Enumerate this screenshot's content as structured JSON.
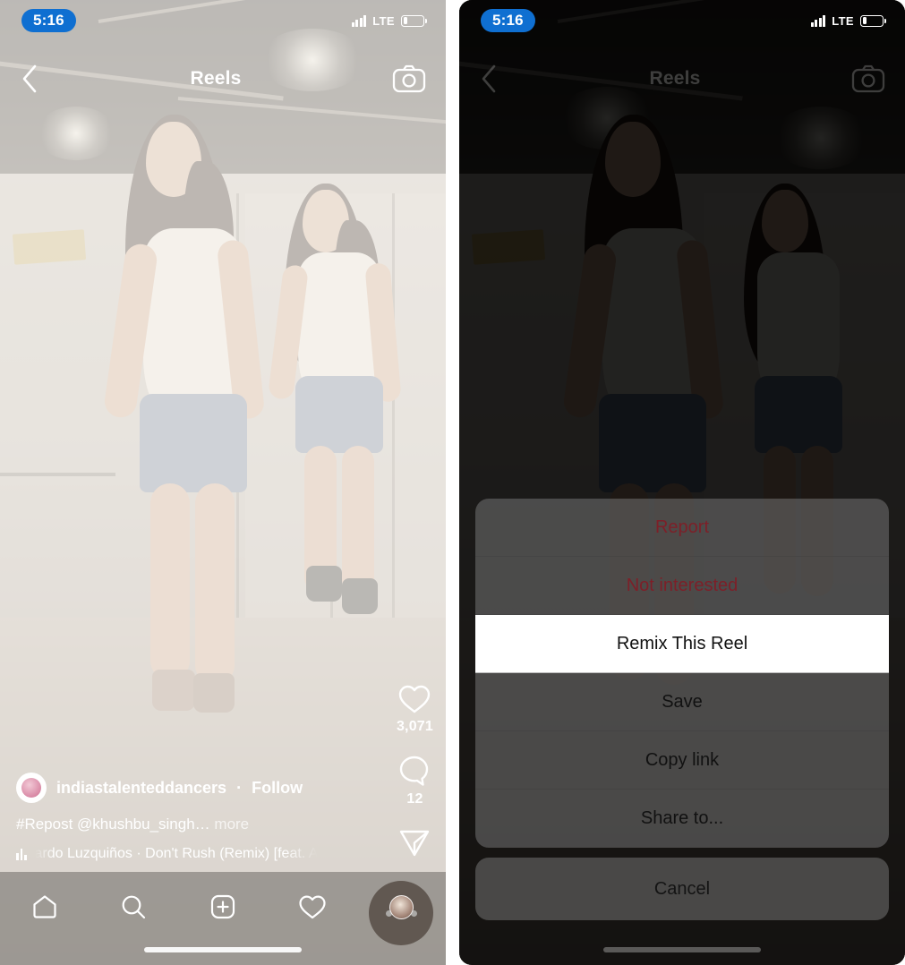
{
  "status_bar": {
    "time": "5:16",
    "carrier_network": "LTE",
    "signal_icon": "signal-bars-icon",
    "battery_icon": "battery-low-icon",
    "time_pill_color": "#0f6fd1"
  },
  "header": {
    "title": "Reels",
    "back_icon": "chevron-left-icon",
    "camera_icon": "camera-icon"
  },
  "reel": {
    "actions": {
      "like_icon": "heart-icon",
      "like_count": "3,071",
      "comment_icon": "comment-bubble-icon",
      "comment_count": "12",
      "share_icon": "paper-plane-icon",
      "more_icon": "ellipsis-icon"
    },
    "author": {
      "avatar_icon": "profile-avatar",
      "username": "indiastalenteddancers",
      "separator": "·",
      "follow_label": "Follow"
    },
    "caption": {
      "text": "#Repost @khushbu_singh…",
      "more_label": "more"
    },
    "audio": {
      "music_icon": "audio-waveform-icon",
      "track": "ardo Luzquiños · Don't Rush (Remix) [feat. A"
    }
  },
  "tab_bar": {
    "items": [
      {
        "name": "home",
        "icon": "home-icon"
      },
      {
        "name": "search",
        "icon": "search-icon"
      },
      {
        "name": "create",
        "icon": "plus-square-icon"
      },
      {
        "name": "activity",
        "icon": "heart-icon"
      },
      {
        "name": "profile",
        "icon": "profile-avatar-icon"
      }
    ]
  },
  "action_sheet": {
    "items": [
      {
        "label": "Report",
        "style": "destructive"
      },
      {
        "label": "Not interested",
        "style": "destructive"
      },
      {
        "label": "Remix This Reel",
        "style": "highlight"
      },
      {
        "label": "Save",
        "style": "default"
      },
      {
        "label": "Copy link",
        "style": "default"
      },
      {
        "label": "Share to...",
        "style": "default"
      }
    ],
    "cancel_label": "Cancel",
    "destructive_color": "#7d1f28",
    "highlight_bg": "#ffffff"
  }
}
